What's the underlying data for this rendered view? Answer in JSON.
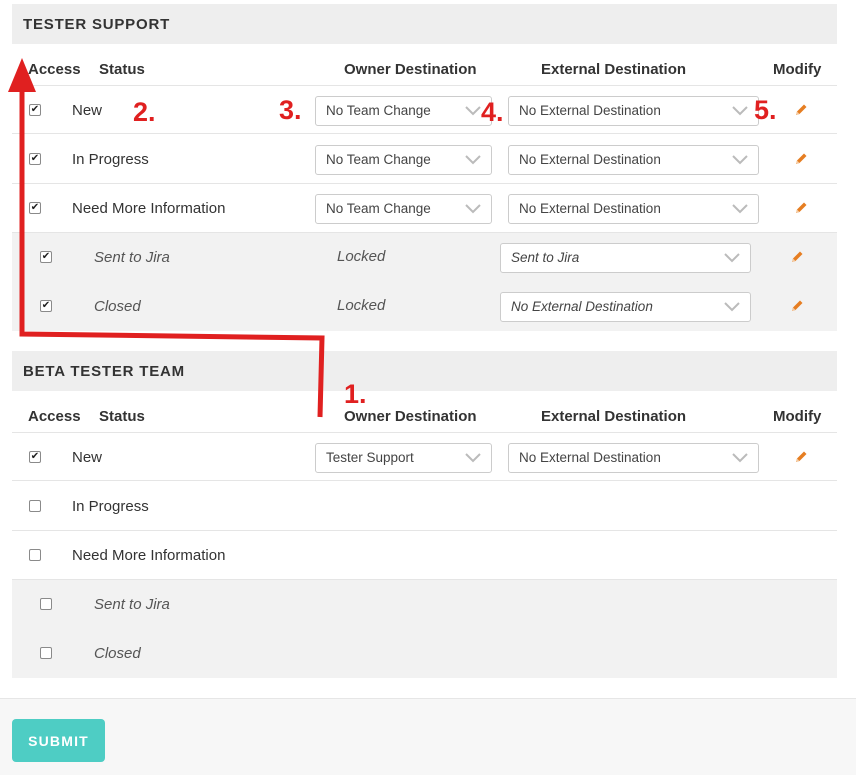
{
  "sections": [
    {
      "title": "TESTER SUPPORT",
      "columns": {
        "access": "Access",
        "status": "Status",
        "owner": "Owner Destination",
        "external": "External Destination",
        "modify": "Modify"
      },
      "rows": [
        {
          "status": "New",
          "checked": true,
          "owner": "No Team Change",
          "external": "No External Destination"
        },
        {
          "status": "In Progress",
          "checked": true,
          "owner": "No Team Change",
          "external": "No External Destination"
        },
        {
          "status": "Need More Information",
          "checked": true,
          "owner": "No Team Change",
          "external": "No External Destination"
        },
        {
          "status": "Sent to Jira",
          "checked": true,
          "owner": "Locked",
          "external": "Sent to Jira"
        },
        {
          "status": "Closed",
          "checked": true,
          "owner": "Locked",
          "external": "No External Destination"
        }
      ]
    },
    {
      "title": "BETA TESTER TEAM",
      "columns": {
        "access": "Access",
        "status": "Status",
        "owner": "Owner Destination",
        "external": "External Destination",
        "modify": "Modify"
      },
      "rows": [
        {
          "status": "New",
          "checked": true,
          "owner": "Tester Support",
          "external": "No External Destination"
        },
        {
          "status": "In Progress",
          "checked": false
        },
        {
          "status": "Need More Information",
          "checked": false
        },
        {
          "status": "Sent to Jira",
          "checked": false
        },
        {
          "status": "Closed",
          "checked": false
        }
      ]
    }
  ],
  "annotations": {
    "a1": "1.",
    "a2": "2.",
    "a3": "3.",
    "a4": "4.",
    "a5": "5."
  },
  "submit_label": "SUBMIT",
  "colors": {
    "annotation": "#e02020",
    "accent": "#4ecdc4",
    "pencil": "#e67e22"
  },
  "icons": {
    "select": "chevron-down-icon",
    "modify": "pencil-icon",
    "access": "checkbox"
  }
}
